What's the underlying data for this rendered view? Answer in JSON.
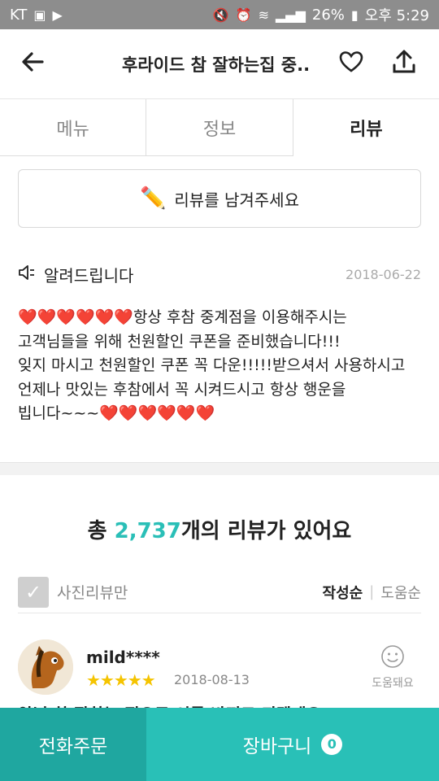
{
  "status_bar": {
    "carrier": "KT",
    "battery": "26%",
    "time": "오후 5:29"
  },
  "app_bar": {
    "title": "후라이드 참 잘하는집 중.."
  },
  "tabs": [
    {
      "label": "메뉴"
    },
    {
      "label": "정보"
    },
    {
      "label": "리뷰"
    }
  ],
  "write_review": {
    "label": "리뷰를 남겨주세요"
  },
  "notice": {
    "title": "알려드립니다",
    "date": "2018-06-22",
    "body": "❤️❤️❤️❤️❤️❤️항상 후참 중계점을 이용해주시는\n고객님들을 위해 천원할인 쿠폰을 준비했습니다!!!\n잊지 마시고 천원할인 쿠폰 꼭 다운!!!!!받으셔서 사용하시고\n언제나 맛있는 후참에서 꼭 시켜드시고 항상 행운을\n빕니다~~~❤️❤️❤️❤️❤️❤️"
  },
  "review_count": {
    "prefix": "총 ",
    "number": "2,737",
    "suffix": "개의 리뷰가 있어요"
  },
  "filter": {
    "photo_only": "사진리뷰만",
    "sort_latest": "작성순",
    "sort_helpful": "도움순"
  },
  "review": {
    "name": "mild****",
    "stars": "★★★★★",
    "rating": 5,
    "date": "2018-08-13",
    "helpful_label": "도움돼요",
    "text": "양념 참 잘하는 집으로 이름 바꿔도 되겠네요!"
  },
  "bottom_bar": {
    "call_label": "전화주문",
    "cart_label": "장바구니",
    "cart_count": "0"
  },
  "colors": {
    "accent": "#29c0b7",
    "accent_dark": "#1fa7a0",
    "status_bar": "#8d8d8d"
  }
}
